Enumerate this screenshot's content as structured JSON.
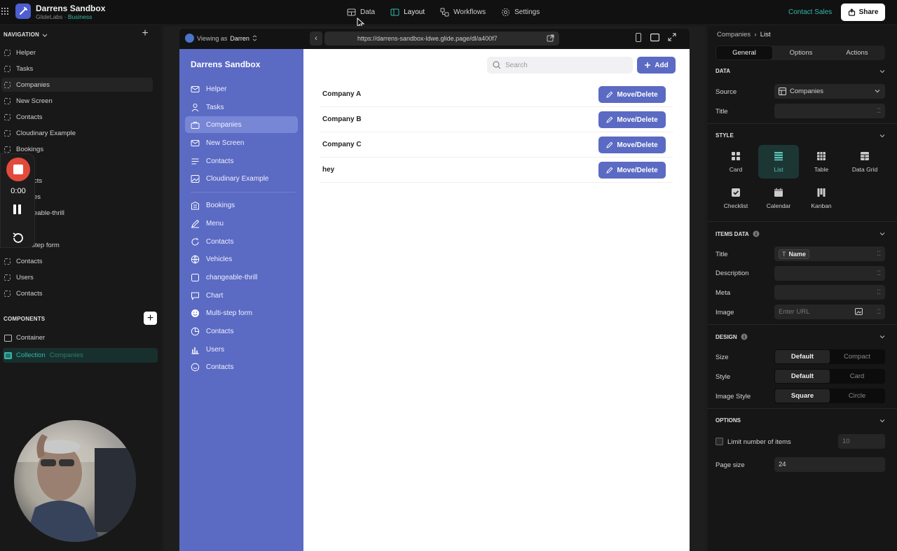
{
  "topbar": {
    "app_title": "Darrens Sandbox",
    "org": "GlideLabs",
    "plan": "Business",
    "nav": [
      {
        "label": "Data",
        "icon": "table-icon"
      },
      {
        "label": "Layout",
        "icon": "layout-icon"
      },
      {
        "label": "Workflows",
        "icon": "workflow-icon"
      },
      {
        "label": "Settings",
        "icon": "gear-icon"
      }
    ],
    "contact_sales": "Contact Sales",
    "share": "Share"
  },
  "left": {
    "navigation_title": "NAVIGATION",
    "nav_items": [
      "Helper",
      "Tasks",
      "Companies",
      "New Screen",
      "Contacts",
      "Cloudinary Example",
      "Bookings",
      "Menu",
      "Contacts",
      "Vehicles",
      "changeable-thrill",
      "Chart",
      "Multi-step form",
      "Contacts",
      "Users",
      "Contacts"
    ],
    "nav_visible": [
      "Helper",
      "Tasks",
      "Companies",
      "New Screen",
      "Contacts",
      "Cloudinary Example",
      "Bookings",
      "cts",
      "es",
      "eable-thrill",
      "",
      "Multi-step form",
      "Contacts",
      "Users",
      "Contacts"
    ],
    "components_title": "COMPONENTS",
    "components": [
      {
        "label": "Container",
        "sub": ""
      },
      {
        "label": "Collection",
        "sub": "Companies"
      }
    ]
  },
  "recorder": {
    "time": "0:00"
  },
  "preview": {
    "viewing_as": "Viewing as",
    "viewer": "Darren",
    "url": "https://darrens-sandbox-ldwe.glide.page/dl/a400f7",
    "brand": "Darrens Sandbox",
    "menu": [
      {
        "label": "Helper",
        "icon": "mail-icon"
      },
      {
        "label": "Tasks",
        "icon": "person-icon"
      },
      {
        "label": "Companies",
        "icon": "briefcase-icon"
      },
      {
        "label": "New Screen",
        "icon": "mail-icon"
      },
      {
        "label": "Contacts",
        "icon": "lines-icon"
      },
      {
        "label": "Cloudinary Example",
        "icon": "image-icon"
      },
      {
        "label": "Bookings",
        "icon": "building-icon"
      },
      {
        "label": "Menu",
        "icon": "edit-icon"
      },
      {
        "label": "Contacts",
        "icon": "refresh-icon"
      },
      {
        "label": "Vehicles",
        "icon": "globe-icon"
      },
      {
        "label": "changeable-thrill",
        "icon": "square-icon"
      },
      {
        "label": "Chart",
        "icon": "chat-icon"
      },
      {
        "label": "Multi-step form",
        "icon": "smile-icon"
      },
      {
        "label": "Contacts",
        "icon": "pie-icon"
      },
      {
        "label": "Users",
        "icon": "bar-chart-icon"
      },
      {
        "label": "Contacts",
        "icon": "circle-minus-icon"
      }
    ],
    "search_placeholder": "Search",
    "add_label": "Add",
    "rows": [
      {
        "name": "Company A",
        "action": "Move/Delete"
      },
      {
        "name": "Company B",
        "action": "Move/Delete"
      },
      {
        "name": "Company C",
        "action": "Move/Delete"
      },
      {
        "name": "hey",
        "action": "Move/Delete"
      }
    ]
  },
  "right": {
    "crumb_parent": "Companies",
    "crumb_current": "List",
    "tabs": [
      "General",
      "Options",
      "Actions"
    ],
    "data_title": "DATA",
    "source_label": "Source",
    "source_value": "Companies",
    "title_label": "Title",
    "style_title": "STYLE",
    "styles": [
      "Card",
      "List",
      "Table",
      "Data Grid",
      "Checklist",
      "Calendar",
      "Kanban"
    ],
    "items_data_title": "ITEMS DATA",
    "item_title_label": "Title",
    "item_title_value": "Name",
    "description_label": "Description",
    "meta_label": "Meta",
    "image_label": "Image",
    "image_placeholder": "Enter URL",
    "design_title": "DESIGN",
    "size_label": "Size",
    "size_options": [
      "Default",
      "Compact"
    ],
    "style_label": "Style",
    "style_options": [
      "Default",
      "Card"
    ],
    "image_style_label": "Image Style",
    "image_style_options": [
      "Square",
      "Circle"
    ],
    "options_title": "OPTIONS",
    "limit_label": "Limit number of items",
    "limit_value": "10",
    "page_size_label": "Page size",
    "page_size_value": "24"
  },
  "colors": {
    "accent": "#5b6ac3",
    "teal": "#35b7a8",
    "record": "#e24a3b"
  }
}
